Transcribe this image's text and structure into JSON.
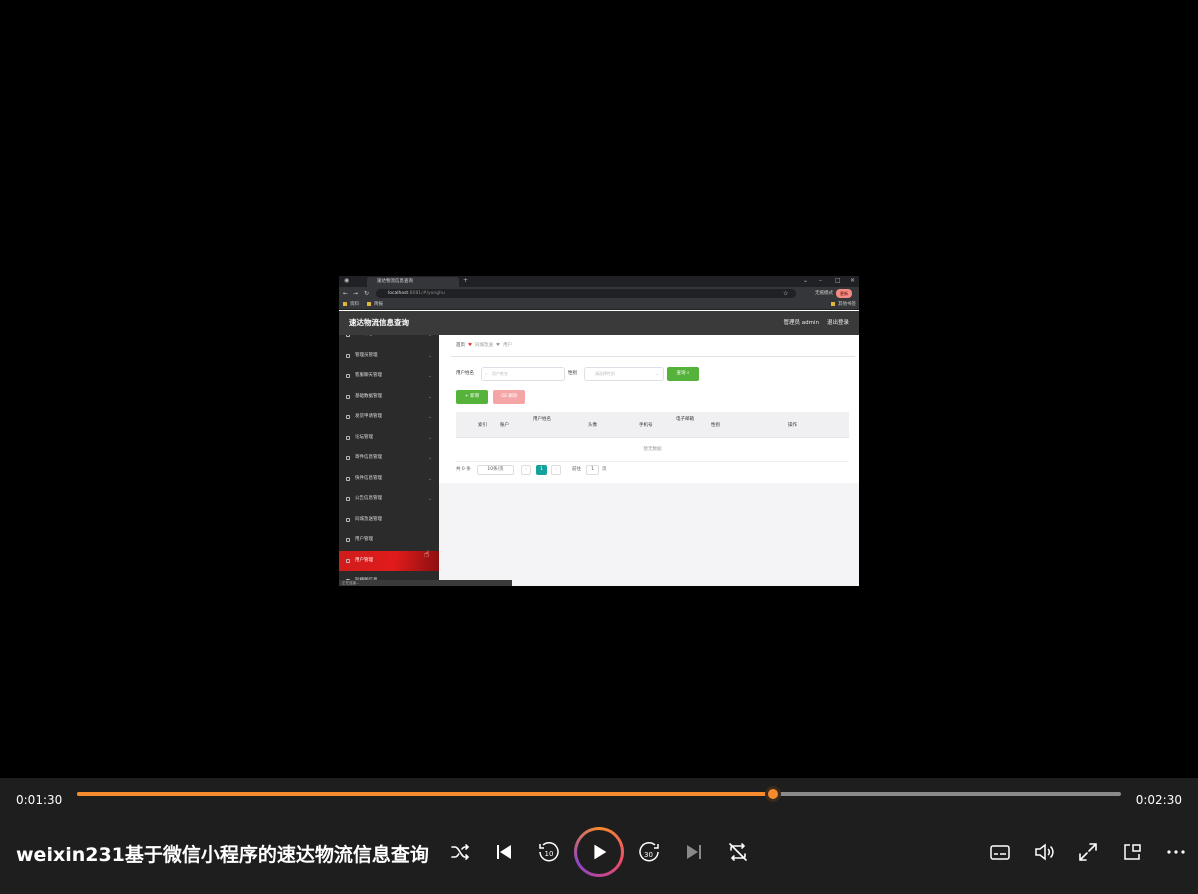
{
  "browser": {
    "tab_title": "速达物流信息查询",
    "url_host": "localhost",
    "url_path": ":8081/#/yonghu",
    "mode_label": "无痕模式",
    "error_label": "更新",
    "bookmarks": [
      "资料",
      "简报"
    ],
    "bookmarks_right": "其他书签"
  },
  "app": {
    "title": "速达物流信息查询",
    "user_label": "管理员 admin",
    "logout_label": "退出登录"
  },
  "sidebar": {
    "items": [
      {
        "label": "个人中心",
        "active": false
      },
      {
        "label": "管理员管理",
        "active": false
      },
      {
        "label": "客服聊天管理",
        "active": false
      },
      {
        "label": "基础数据管理",
        "active": false
      },
      {
        "label": "发货申请管理",
        "active": false
      },
      {
        "label": "论坛管理",
        "active": false
      },
      {
        "label": "寄件信息管理",
        "active": false
      },
      {
        "label": "快件信息管理",
        "active": false
      },
      {
        "label": "公告信息管理",
        "active": false
      },
      {
        "label": "同城急送管理",
        "active": false
      },
      {
        "label": "用户管理",
        "active": false
      },
      {
        "label": "用户管理",
        "active": true
      },
      {
        "label": "轮播图信息",
        "active": false
      }
    ]
  },
  "breadcrumb": {
    "home": "首页",
    "level1": "同城急送",
    "level2": "用户"
  },
  "search": {
    "name_label": "用户姓名",
    "name_placeholder": "用户姓名",
    "gender_label": "性别",
    "gender_placeholder": "请选择性别",
    "query_button": "查询"
  },
  "actions": {
    "add": "新增",
    "delete": "删除"
  },
  "table": {
    "headers": [
      "索引",
      "账户",
      "用户姓名",
      "头像",
      "手机号",
      "电子邮箱",
      "性别",
      "操作"
    ],
    "empty_text": "暂无数据"
  },
  "pager": {
    "total": "共 0 条",
    "page_size": "10条/页",
    "current_page": "1",
    "goto_label": "前往",
    "goto_value": "1",
    "page_suffix": "页"
  },
  "statusbar": "正在连接...",
  "player": {
    "current_time": "0:01:30",
    "total_time": "0:02:30",
    "progress": 0.6667,
    "video_title": "weixin231基于微信小程序的速达物流信息查询",
    "skip_back_seconds": "10",
    "skip_forward_seconds": "30",
    "accent_color": "#f58b2c"
  }
}
